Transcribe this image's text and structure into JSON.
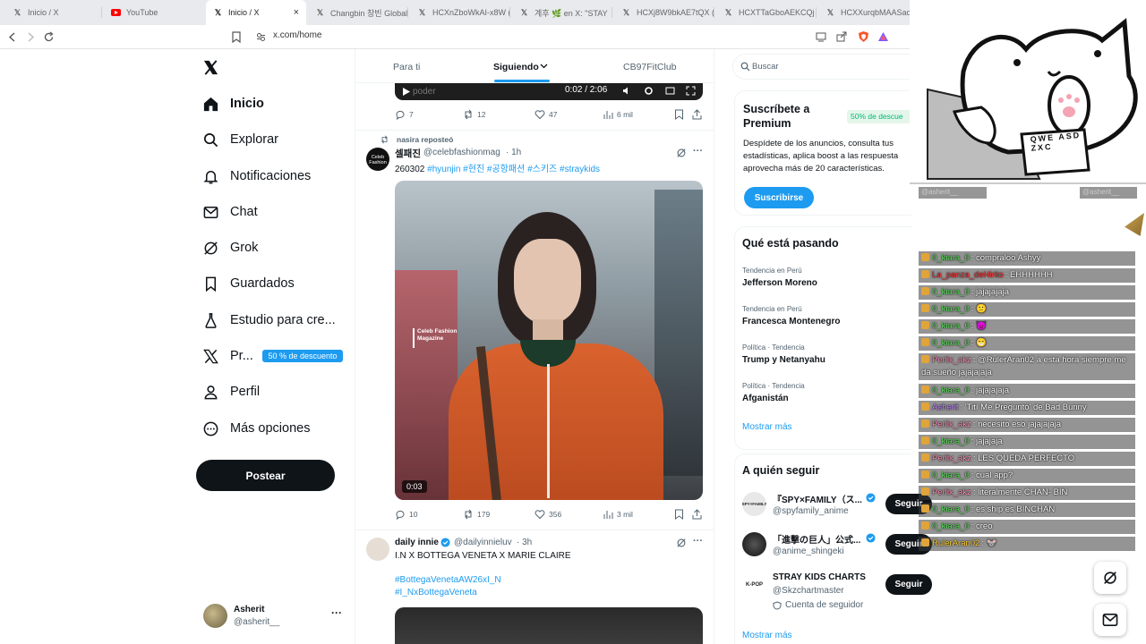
{
  "browser": {
    "tabs": [
      {
        "title": "Inicio / X",
        "icon": "x-logo-icon"
      },
      {
        "title": "YouTube",
        "icon": "youtube-icon"
      },
      {
        "title": "Inicio / X",
        "icon": "x-logo-icon",
        "active": true
      },
      {
        "title": "Changbin 창빈 Global",
        "icon": "x-logo-icon"
      },
      {
        "title": "HCXnZboWkAI-x8W (",
        "icon": "x-logo-icon"
      },
      {
        "title": "계후 🌿 en X: \"STAY",
        "icon": "x-logo-icon"
      },
      {
        "title": "HCXj8W9bkAE7tQX (1",
        "icon": "x-logo-icon"
      },
      {
        "title": "HCXTTaGboAEKCQj (1",
        "icon": "x-logo-icon"
      },
      {
        "title": "HCXXurqbMAASao7",
        "icon": "x-logo-icon"
      }
    ],
    "url": "x.com/home"
  },
  "sidebar": {
    "items": [
      {
        "label": "Inicio",
        "icon": "home-icon"
      },
      {
        "label": "Explorar",
        "icon": "search-icon"
      },
      {
        "label": "Notificaciones",
        "icon": "bell-icon"
      },
      {
        "label": "Chat",
        "icon": "mail-icon"
      },
      {
        "label": "Grok",
        "icon": "grok-icon"
      },
      {
        "label": "Guardados",
        "icon": "bookmark-icon"
      },
      {
        "label": "Estudio para cre...",
        "icon": "flask-icon"
      },
      {
        "label": "Pr...",
        "icon": "x-logo-icon"
      },
      {
        "label": "Perfil",
        "icon": "person-icon"
      },
      {
        "label": "Más opciones",
        "icon": "more-circle-icon"
      }
    ],
    "promo_badge": "50 % de descuento",
    "post_button": "Postear",
    "account": {
      "name": "Asherit",
      "handle": "@asherit__"
    }
  },
  "feed": {
    "tabs": [
      "Para ti",
      "Siguiendo",
      "CB97FitClub"
    ],
    "video1": {
      "time": "0:02 / 2:06",
      "watermark": "poder"
    },
    "post1_stats": {
      "replies": "7",
      "reposts": "12",
      "likes": "47",
      "views": "6 mil"
    },
    "post2": {
      "reposted_by": "nasira reposteó",
      "avatar_text": "Celeb Fashion",
      "name": "셀패진",
      "handle": "@celebfashionmag",
      "time": "· 1h",
      "text_prefix": "260302 ",
      "hashtags": "#hyunjin #현진 #공항패션 #스키즈 #straykids",
      "video_duration": "0:03",
      "watermark": "Celeb Fashion Magazine",
      "stats": {
        "replies": "10",
        "reposts": "179",
        "likes": "356",
        "views": "3 mil"
      }
    },
    "post3": {
      "name": "daily innie",
      "handle": "@dailyinnieluv",
      "time": "· 3h",
      "text": "I.N X BOTTEGA VENETA X MARIE CLAIRE",
      "hashtag1": "#BottegaVenetaAW26xI_N",
      "hashtag2": "#I_NxBottegaVeneta"
    }
  },
  "right": {
    "search_placeholder": "Buscar",
    "premium": {
      "title": "Suscríbete a Premium",
      "badge": "50% de descue",
      "text": "Despídete de los anuncios, consulta tus estadísticas, aplica boost a las respuesta aprovecha más de 20 características.",
      "button": "Suscribirse"
    },
    "trends_title": "Qué está pasando",
    "trends": [
      {
        "meta": "Tendencia en Perú",
        "name": "Jefferson Moreno"
      },
      {
        "meta": "Tendencia en Perú",
        "name": "Francesca Montenegro"
      },
      {
        "meta": "Política · Tendencia",
        "name": "Trump y Netanyahu"
      },
      {
        "meta": "Política · Tendencia",
        "name": "Afganistán"
      }
    ],
    "show_more": "Mostrar más",
    "follow_title": "A quién seguir",
    "follow": [
      {
        "name": "『SPY×FAMILY（ス...",
        "handle": "@spyfamily_anime",
        "button": "Seguir",
        "verified": true,
        "avatar": "SPY×FAMILY"
      },
      {
        "name": "「進撃の巨人」公式...",
        "handle": "@anime_shingeki",
        "button": "Seguir",
        "verified": true,
        "avatar": ""
      },
      {
        "name": "STRAY KIDS CHARTS",
        "handle": "@Skzchartmaster",
        "button": "Seguir",
        "verified": false,
        "avatar": "K-POP",
        "note": "Cuenta de seguidor"
      }
    ],
    "show_more2": "Mostrar más"
  },
  "overlay": {
    "top_names": [
      "@asherit__",
      "@asherit__"
    ],
    "cat_keys": "QWE ASD ZXC",
    "chat": [
      {
        "user": "0_kiara_0",
        "msg": ": compraloo Ashyy",
        "color": "#5ee35e"
      },
      {
        "user": "La_panza_deHirito",
        "msg": ": EHHHHHH",
        "color": "#ff3b3b"
      },
      {
        "user": "0_kiara_0",
        "msg": ": jajajajaja",
        "color": "#5ee35e"
      },
      {
        "user": "0_kiara_0",
        "msg": ": 🙂",
        "color": "#5ee35e"
      },
      {
        "user": "0_kiara_0",
        "msg": ": 😈",
        "color": "#5ee35e"
      },
      {
        "user": "0_kiara_0",
        "msg": ": 😁",
        "color": "#5ee35e"
      },
      {
        "user": "Perlix_akz",
        "msg": ": @RulerAran02 a esta hora siempre me da sueño jajajajaja",
        "color": "#ff8fb1"
      },
      {
        "user": "0_kiara_0",
        "msg": ": jajajajaja",
        "color": "#5ee35e"
      },
      {
        "user": "Asherit",
        "msg": ": 'Tití Me Preguntó' de Bad Bunny",
        "color": "#c38bff"
      },
      {
        "user": "Perlix_akz",
        "msg": ": necesito eso jajajajaja",
        "color": "#ff8fb1"
      },
      {
        "user": "0_kiara_0",
        "msg": ": jajajaja",
        "color": "#5ee35e"
      },
      {
        "user": "Perlix_akz",
        "msg": ": LES QUEDA PERFECTO",
        "color": "#ff8fb1"
      },
      {
        "user": "0_kiara_0",
        "msg": ": cual app?",
        "color": "#5ee35e"
      },
      {
        "user": "Perlix_akz",
        "msg": ": literalmente CHAN- BIN",
        "color": "#ff8fb1"
      },
      {
        "user": "0_kiara_0",
        "msg": ": es ship es BINCHAN",
        "color": "#5ee35e"
      },
      {
        "user": "0_kiara_0",
        "msg": ": creo",
        "color": "#5ee35e"
      },
      {
        "user": "RulerAran02",
        "msg": ": 🐭",
        "color": "#ffd23a"
      }
    ]
  },
  "colors": {
    "accent": "#1d9bf0",
    "text": "#0f1419",
    "muted": "#536471"
  }
}
